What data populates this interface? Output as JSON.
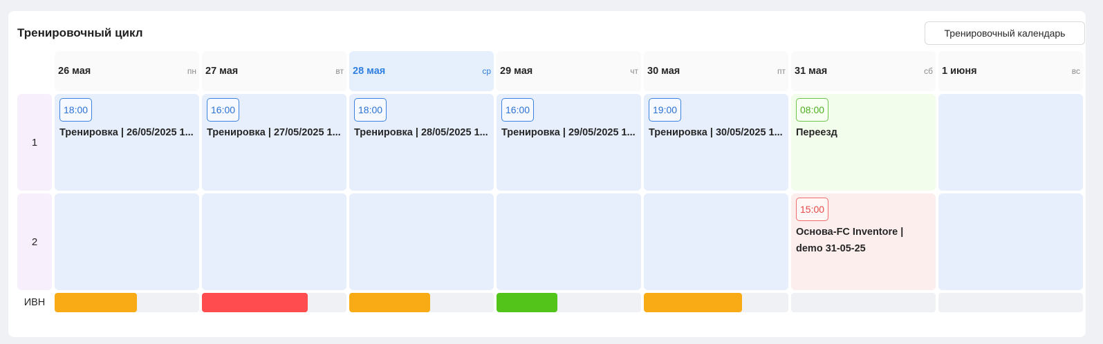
{
  "title": "Тренировочный цикл",
  "calendar_button": "Тренировочный календарь",
  "days": [
    {
      "date": "26 мая",
      "weekday": "пн",
      "today": false
    },
    {
      "date": "27 мая",
      "weekday": "вт",
      "today": false
    },
    {
      "date": "28 мая",
      "weekday": "ср",
      "today": true
    },
    {
      "date": "29 мая",
      "weekday": "чт",
      "today": false
    },
    {
      "date": "30 мая",
      "weekday": "пт",
      "today": false
    },
    {
      "date": "31 мая",
      "weekday": "сб",
      "today": false
    },
    {
      "date": "1 июня",
      "weekday": "вс",
      "today": false
    }
  ],
  "rows": [
    {
      "label": "1",
      "cells": [
        {
          "time": "18:00",
          "title": "Тренировка | 26/05/2025 1...",
          "type": "blue"
        },
        {
          "time": "16:00",
          "title": "Тренировка | 27/05/2025 1...",
          "type": "blue"
        },
        {
          "time": "18:00",
          "title": "Тренировка | 28/05/2025 1...",
          "type": "blue"
        },
        {
          "time": "16:00",
          "title": "Тренировка | 29/05/2025 1...",
          "type": "blue"
        },
        {
          "time": "19:00",
          "title": "Тренировка | 30/05/2025 1...",
          "type": "blue"
        },
        {
          "time": "08:00",
          "title": "Переезд",
          "type": "green"
        },
        null
      ]
    },
    {
      "label": "2",
      "cells": [
        null,
        null,
        null,
        null,
        null,
        {
          "time": "15:00",
          "title": "Основа-FC Inventore | demo 31-05-25",
          "type": "red"
        },
        null
      ]
    }
  ],
  "ivn": {
    "label": "ИВН",
    "bars": [
      {
        "fraction": 0.57,
        "color": "#f9ab15"
      },
      {
        "fraction": 0.73,
        "color": "#ff4d4f"
      },
      {
        "fraction": 0.56,
        "color": "#f9ab15"
      },
      {
        "fraction": 0.42,
        "color": "#52c41a"
      },
      {
        "fraction": 0.68,
        "color": "#f9ab15"
      },
      {
        "fraction": 0,
        "color": "#f9ab15"
      },
      {
        "fraction": 0,
        "color": "#f9ab15"
      }
    ]
  }
}
